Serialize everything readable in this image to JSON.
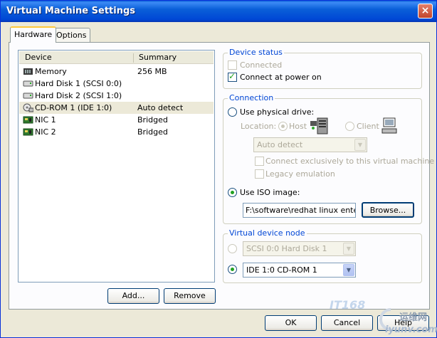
{
  "window": {
    "title": "Virtual Machine Settings",
    "close_glyph": "×"
  },
  "tabs": [
    {
      "label": "Hardware",
      "active": true
    },
    {
      "label": "Options",
      "active": false
    }
  ],
  "device_list": {
    "columns": [
      "Device",
      "Summary"
    ],
    "rows": [
      {
        "device": "Memory",
        "summary": "256 MB",
        "icon": "memory-icon",
        "selected": false
      },
      {
        "device": "Hard Disk 1 (SCSI 0:0)",
        "summary": "",
        "icon": "hard-disk-icon",
        "selected": false
      },
      {
        "device": "Hard Disk 2 (SCSI 1:0)",
        "summary": "",
        "icon": "hard-disk-icon",
        "selected": false
      },
      {
        "device": "CD-ROM 1 (IDE 1:0)",
        "summary": "Auto detect",
        "icon": "cdrom-icon",
        "selected": true
      },
      {
        "device": "NIC 1",
        "summary": "Bridged",
        "icon": "network-card-icon",
        "selected": false
      },
      {
        "device": "NIC 2",
        "summary": "Bridged",
        "icon": "network-card-icon",
        "selected": false
      }
    ]
  },
  "buttons": {
    "add": "Add...",
    "remove": "Remove",
    "ok": "OK",
    "cancel": "Cancel",
    "help": "Help",
    "browse": "Browse..."
  },
  "device_status": {
    "title": "Device status",
    "connected": {
      "label": "Connected",
      "checked": false,
      "enabled": false
    },
    "connect_power_on": {
      "label": "Connect at power on",
      "checked": true,
      "enabled": true
    }
  },
  "connection": {
    "title": "Connection",
    "use_physical": {
      "label": "Use physical drive:",
      "selected": false
    },
    "location_label": "Location:",
    "host_label": "Host",
    "client_label": "Client",
    "drive_select": "Auto detect",
    "connect_exclusive": "Connect exclusively to this virtual machine",
    "legacy_emulation": "Legacy emulation",
    "use_iso": {
      "label": "Use ISO image:",
      "selected": true
    },
    "iso_path": "F:\\software\\redhat linux enterpri"
  },
  "virtual_device_node": {
    "title": "Virtual device node",
    "scsi_option": "SCSI 0:0   Hard Disk 1",
    "ide_option": "IDE 1:0   CD-ROM 1"
  },
  "watermark": {
    "left_text": "IT168",
    "right_cn": "运维网",
    "right_url": "iyunv.com"
  },
  "colors": {
    "title_bar": "#0054e3",
    "group_title": "#0046d5",
    "checkmark": "#21a121",
    "dialog_bg": "#ece9d8"
  }
}
